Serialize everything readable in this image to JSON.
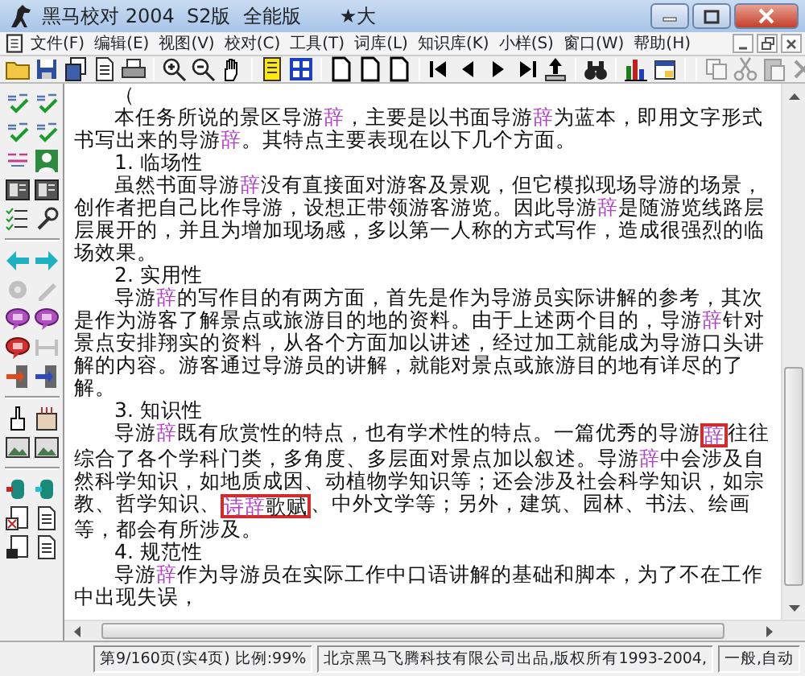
{
  "window": {
    "title": "黑马校对 2004  S2版  全能版",
    "title_extra": "★大"
  },
  "menu": [
    "文件(F)",
    "编辑(E)",
    "视图(V)",
    "校对(C)",
    "工具(T)",
    "词库(L)",
    "知识库(K)",
    "小样(S)",
    "窗口(W)",
    "帮助(H)"
  ],
  "toolbar": [
    {
      "kind": "button",
      "disabled": false
    },
    {
      "kind": "button",
      "disabled": false
    },
    {
      "kind": "button",
      "disabled": false
    },
    {
      "kind": "button",
      "disabled": false
    },
    {
      "kind": "button",
      "disabled": false
    },
    {
      "kind": "separator"
    },
    {
      "kind": "button",
      "disabled": false
    },
    {
      "kind": "button",
      "disabled": false
    },
    {
      "kind": "button",
      "disabled": false
    },
    {
      "kind": "separator"
    },
    {
      "kind": "button",
      "disabled": false
    },
    {
      "kind": "button",
      "disabled": false
    },
    {
      "kind": "separator"
    },
    {
      "kind": "button",
      "disabled": false
    },
    {
      "kind": "button",
      "disabled": false
    },
    {
      "kind": "button",
      "disabled": false
    },
    {
      "kind": "separator"
    },
    {
      "kind": "button",
      "disabled": false
    },
    {
      "kind": "button",
      "disabled": false
    },
    {
      "kind": "button",
      "disabled": false
    },
    {
      "kind": "button",
      "disabled": false
    },
    {
      "kind": "button",
      "disabled": false
    },
    {
      "kind": "separator"
    },
    {
      "kind": "button",
      "disabled": false
    },
    {
      "kind": "separator"
    },
    {
      "kind": "button",
      "disabled": false
    },
    {
      "kind": "button",
      "disabled": false
    },
    {
      "kind": "separator"
    },
    {
      "kind": "separator"
    },
    {
      "kind": "button",
      "disabled": true
    },
    {
      "kind": "button",
      "disabled": true
    },
    {
      "kind": "button",
      "disabled": true
    },
    {
      "kind": "button",
      "disabled": true
    }
  ],
  "left_toolbar": [
    {
      "kind": "button",
      "disabled": false
    },
    {
      "kind": "button",
      "disabled": false
    },
    {
      "kind": "button",
      "disabled": false
    },
    {
      "kind": "button",
      "disabled": false
    },
    {
      "kind": "button",
      "disabled": false
    },
    {
      "kind": "button",
      "disabled": false
    },
    {
      "kind": "button",
      "disabled": false
    },
    {
      "kind": "button",
      "disabled": false
    },
    {
      "kind": "button",
      "disabled": false
    },
    {
      "kind": "button",
      "disabled": false
    },
    {
      "kind": "separator"
    },
    {
      "kind": "button",
      "disabled": false
    },
    {
      "kind": "button",
      "disabled": false
    },
    {
      "kind": "button",
      "disabled": true
    },
    {
      "kind": "button",
      "disabled": true
    },
    {
      "kind": "button",
      "disabled": false
    },
    {
      "kind": "button",
      "disabled": false
    },
    {
      "kind": "button",
      "disabled": false
    },
    {
      "kind": "button",
      "disabled": true
    },
    {
      "kind": "button",
      "disabled": false
    },
    {
      "kind": "button",
      "disabled": false
    },
    {
      "kind": "separator"
    },
    {
      "kind": "button",
      "disabled": false
    },
    {
      "kind": "button",
      "disabled": false
    },
    {
      "kind": "button",
      "disabled": false
    },
    {
      "kind": "button",
      "disabled": false
    },
    {
      "kind": "separator"
    },
    {
      "kind": "button",
      "disabled": false
    },
    {
      "kind": "button",
      "disabled": false
    },
    {
      "kind": "button",
      "disabled": false
    },
    {
      "kind": "button",
      "disabled": false
    },
    {
      "kind": "button",
      "disabled": false
    },
    {
      "kind": "button",
      "disabled": false
    }
  ],
  "document": [
    {
      "kind": "heading",
      "text": "（"
    },
    {
      "kind": "paragraph",
      "segments": [
        {
          "text": "本任务所说的景区导游",
          "flagged": false
        },
        {
          "text": "辞",
          "flagged": true
        },
        {
          "text": "，主要是以书面导游",
          "flagged": false
        },
        {
          "text": "辞",
          "flagged": true
        },
        {
          "text": "为蓝本，即用文字形式书写出来的导游",
          "flagged": false
        },
        {
          "text": "辞",
          "flagged": true
        },
        {
          "text": "。其特点主要表现在以下几个方面。",
          "flagged": false
        }
      ]
    },
    {
      "kind": "heading",
      "text": "1. 临场性"
    },
    {
      "kind": "paragraph",
      "segments": [
        {
          "text": "虽然书面导游",
          "flagged": false
        },
        {
          "text": "辞",
          "flagged": true
        },
        {
          "text": "没有直接面对游客及景观，但它模拟现场导游的场景，创作者把自己比作导游，设想正带领游客游览。因此导游",
          "flagged": false
        },
        {
          "text": "辞",
          "flagged": true
        },
        {
          "text": "是随游览线路层层展开的，并且为增加现场感，多以第一人称的方式写作，造成很强烈的临场效果。",
          "flagged": false
        }
      ]
    },
    {
      "kind": "heading",
      "text": "2. 实用性"
    },
    {
      "kind": "paragraph",
      "segments": [
        {
          "text": "导游",
          "flagged": false
        },
        {
          "text": "辞",
          "flagged": true
        },
        {
          "text": "的写作目的有两方面，首先是作为导游员实际讲解的参考，其次是作为游客了解景点或旅游目的地的资料。由于上述两个目的，导游",
          "flagged": false
        },
        {
          "text": "辞",
          "flagged": true
        },
        {
          "text": "针对景点安排翔实的资料，从各个方面加以讲述，经过加工就能成为导游口头讲解的内容。游客通过导游员的讲解，就能对景点或旅游目的地有详尽的了解。",
          "flagged": false
        }
      ]
    },
    {
      "kind": "heading",
      "text": "3. 知识性"
    },
    {
      "kind": "paragraph",
      "segments": [
        {
          "text": "导游",
          "flagged": false
        },
        {
          "text": "辞",
          "flagged": true
        },
        {
          "text": "既有欣赏性的特点，也有学术性的特点。一篇优秀的导游",
          "flagged": false
        },
        {
          "text": "辞",
          "flagged": true,
          "boxed": true
        },
        {
          "text": "往往综合了各个学科门类，多角度、多层面对景点加以叙述。导游",
          "flagged": false
        },
        {
          "text": "辞",
          "flagged": true
        },
        {
          "text": "中会涉及自然科学知识，如地质成因、动植物学知识等；还会涉及社会科学知识，如宗教、哲学知识、",
          "flagged": false
        },
        {
          "text": "诗辞",
          "flagged": true,
          "boxed": true
        },
        {
          "text": "歌赋",
          "flagged": false,
          "boxed": true
        },
        {
          "text": "、中外文学等；另外，建筑、园林、书法、绘画等，都会有所涉及。",
          "flagged": false
        }
      ]
    },
    {
      "kind": "heading",
      "text": "4. 规范性"
    },
    {
      "kind": "paragraph",
      "segments": [
        {
          "text": "导游",
          "flagged": false
        },
        {
          "text": "辞",
          "flagged": true
        },
        {
          "text": "作为导游员在实际工作中口语讲解的基础和脚本，为了不在工作中出现失误，",
          "flagged": false
        }
      ]
    }
  ],
  "status_bar": [
    "第9/160页(实4页) 比例:99%",
    "北京黑马飞腾科技有限公司出品,版权所有1993-2004,",
    "一般,自动"
  ]
}
